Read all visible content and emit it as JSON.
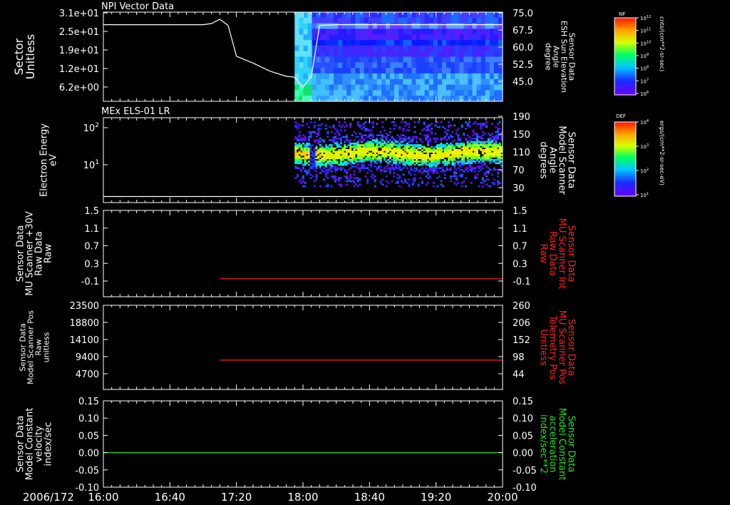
{
  "date_label": "2006/172",
  "time_ticks": [
    "16:00",
    "16:40",
    "17:20",
    "18:00",
    "18:40",
    "19:20",
    "20:00"
  ],
  "colorbars": [
    {
      "title": "NF",
      "unit": "cnts/(cm**2-sr-sec)",
      "ticks": [
        "10^12",
        "10^11",
        "10^10",
        "10^9",
        "10^8",
        "10^7",
        "10^6"
      ]
    },
    {
      "title": "DEF",
      "unit": "ergs/(cm**2-sr-sec-eV)",
      "ticks": [
        "10^4",
        "10^3",
        "10^2",
        "10^1"
      ]
    }
  ],
  "chart_data": [
    {
      "type": "heatmap",
      "title": "NPI Vector Data",
      "ylabel": [
        "Sector",
        "Unitless"
      ],
      "yticks": [
        "3.1e+01",
        "2.5e+01",
        "1.9e+01",
        "1.2e+01",
        "6.2e+00"
      ],
      "y2label": [
        "Sensor Data",
        "ESH Sun Elevation",
        "Angle",
        "degree"
      ],
      "y2ticks": [
        "75.0",
        "67.5",
        "60.0",
        "52.5",
        "45.0"
      ],
      "spectrogram_start": "17:55",
      "overlay_line": {
        "color": "#ffffff",
        "axis": "right",
        "x": [
          "16:00",
          "17:00",
          "17:05",
          "17:10",
          "17:15",
          "17:20",
          "17:30",
          "17:40",
          "17:50",
          "17:55",
          "18:00",
          "18:05",
          "18:10",
          "18:20",
          "20:00"
        ],
        "y": [
          69.8,
          69.8,
          70.3,
          72.2,
          69.5,
          56.0,
          53.0,
          49.5,
          47.2,
          46.8,
          42.5,
          47.0,
          69.5,
          69.8,
          69.8
        ]
      }
    },
    {
      "type": "heatmap",
      "title": "MEx ELS-01 LR",
      "ylabel": [
        "Electron Energy",
        "eV"
      ],
      "yticks": [
        "10^2",
        "10^1"
      ],
      "y2label": [
        "Sensor Data",
        "Model Scanner",
        "Angle",
        "degrees"
      ],
      "y2ticks": [
        "190",
        "150",
        "110",
        "70",
        "30"
      ],
      "spectrogram_start": "17:55",
      "overlay_line": {
        "color": "#ffffff",
        "axis": "right",
        "x": [
          "16:00",
          "20:00"
        ],
        "y": [
          10,
          10
        ]
      }
    },
    {
      "type": "line",
      "ylabel": [
        "Sensor Data",
        "MU Scanner +30V",
        "Raw Data",
        "Raw"
      ],
      "yticks": [
        "1.5",
        "1.1",
        "0.7",
        "0.3",
        "-0.1"
      ],
      "ylim": [
        -0.4,
        1.5
      ],
      "y2label": [
        "Sensor Data",
        "MU Scanner Int",
        "Raw Data",
        "Raw"
      ],
      "y2label_color": "#ff2020",
      "y2ticks": [
        "1.5",
        "1.1",
        "0.7",
        "0.3",
        "-0.1"
      ],
      "series": [
        {
          "color": "#ff2020",
          "axis": "right",
          "x": [
            "17:10",
            "20:00"
          ],
          "y": [
            -0.05,
            -0.05
          ]
        }
      ]
    },
    {
      "type": "line",
      "ylabel": [
        "Sensor Data",
        "Model Scanner Pos",
        "Raw",
        "unitless"
      ],
      "yticks": [
        "23500",
        "18800",
        "14100",
        "9400",
        "4700"
      ],
      "ylim": [
        0,
        23500
      ],
      "y2label": [
        "Sensor Data",
        "MU Scanner Pos",
        "Telemetry Pos",
        "Unitless"
      ],
      "y2label_color": "#ff2020",
      "y2ticks": [
        "260",
        "206",
        "152",
        "98",
        "44"
      ],
      "series": [
        {
          "color": "#ff2020",
          "axis": "right",
          "x": [
            "17:10",
            "20:00"
          ],
          "y": [
            87,
            87
          ]
        }
      ]
    },
    {
      "type": "line",
      "ylabel": [
        "Sensor Data",
        "Model Constant",
        "velocity",
        "index/sec"
      ],
      "yticks": [
        "0.15",
        "0.10",
        "0.05",
        "0.00",
        "-0.05",
        "-0.10"
      ],
      "ylim": [
        -0.1,
        0.15
      ],
      "y2label": [
        "Sensor Data",
        "Model Constant",
        "acceleration",
        "index/sec**2"
      ],
      "y2label_color": "#20e020",
      "y2ticks": [
        "0.15",
        "0.10",
        "0.05",
        "0.00",
        "-0.05",
        "-0.10"
      ],
      "series": [
        {
          "color": "#20e020",
          "axis": "left",
          "x": [
            "16:00",
            "20:00"
          ],
          "y": [
            0.0,
            0.0
          ]
        }
      ]
    }
  ]
}
